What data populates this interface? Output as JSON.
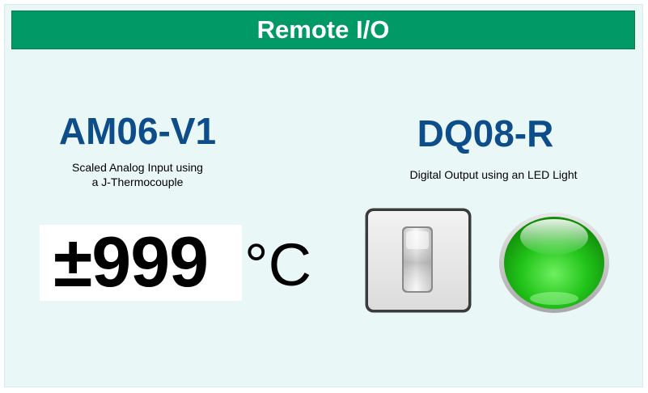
{
  "header": {
    "title": "Remote I/O"
  },
  "analog_module": {
    "name": "AM06-V1",
    "description_line1": "Scaled Analog Input using",
    "description_line2": "a J-Thermocouple",
    "value": "±999",
    "unit": "°C"
  },
  "digital_module": {
    "name": "DQ08-R",
    "description": "Digital Output using an LED Light",
    "switch_state": "on",
    "led_state": "on",
    "led_color": "#22c41a"
  },
  "colors": {
    "title_bar": "#019965",
    "module_name": "#0d4e8a",
    "panel_background": "#eaf7f7"
  }
}
